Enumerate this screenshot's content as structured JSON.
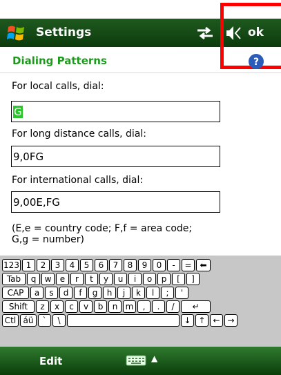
{
  "titlebar": {
    "title": "Settings",
    "ok_label": "ok",
    "icons": [
      "windows-logo-icon",
      "connectivity-icon",
      "speaker-icon"
    ]
  },
  "page": {
    "heading": "Dialing Patterns",
    "help_icon": "help-icon"
  },
  "fields": {
    "local": {
      "label": "For local calls, dial:",
      "value": "G"
    },
    "long_distance": {
      "label": "For long distance calls, dial:",
      "value": "9,0FG"
    },
    "international": {
      "label": "For international calls, dial:",
      "value": "9,00E,FG"
    }
  },
  "note": {
    "line1": "(E,e = country code; F,f = area code;",
    "line2": "G,g = number)"
  },
  "keyboard": {
    "row1": [
      "123",
      "1",
      "2",
      "3",
      "4",
      "5",
      "6",
      "7",
      "8",
      "9",
      "0",
      "-",
      "=",
      "⬅"
    ],
    "row2": [
      "Tab",
      "q",
      "w",
      "e",
      "r",
      "t",
      "y",
      "u",
      "i",
      "o",
      "p",
      "[",
      "]"
    ],
    "row3": [
      "CAP",
      "a",
      "s",
      "d",
      "f",
      "g",
      "h",
      "j",
      "k",
      "l",
      ";",
      "'"
    ],
    "row4": [
      "Shift",
      "z",
      "x",
      "c",
      "v",
      "b",
      "n",
      "m",
      ",",
      ".",
      "/",
      "↵"
    ],
    "row5": [
      "Ctl",
      "áü",
      "`",
      "\\",
      "",
      "↓",
      "↑",
      "←",
      "→"
    ]
  },
  "softbar": {
    "edit_label": "Edit",
    "input_icon": "keyboard-icon",
    "input_caret": "▲"
  },
  "colors": {
    "titlebar_green": "#1f5a1f",
    "heading_green": "#1c9a1c",
    "selection_green": "#2cc52c",
    "highlight_red": "#ff0000"
  }
}
